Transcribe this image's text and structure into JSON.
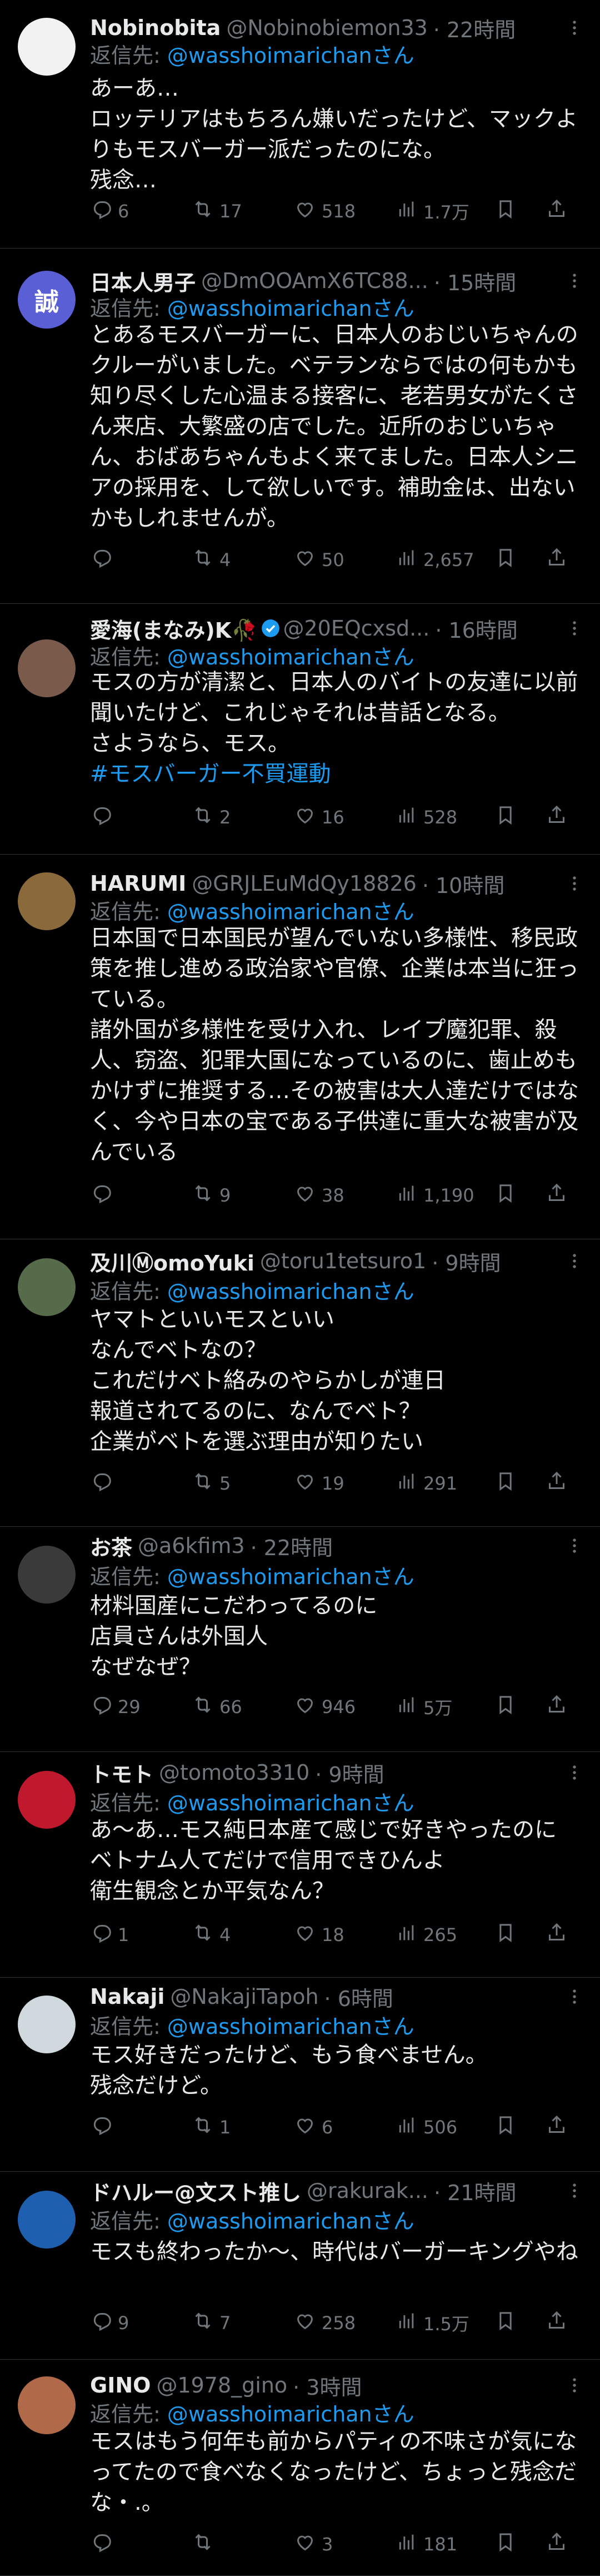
{
  "reply_prefix": "返信先: ",
  "colors": {
    "background": "#000000",
    "text": "#e7e9ea",
    "muted": "#71767b",
    "link": "#1d9bf0",
    "divider": "#2f3336"
  },
  "tweets": [
    {
      "name": "Nobinobita",
      "handle": "@Nobinobiemon33",
      "time": "· 22時間",
      "avatar": {
        "initial": "",
        "bg": "#f2f2f2"
      },
      "reply_to": "@wasshoimarichanさん",
      "text": "あーあ…\nロッテリアはもちろん嫌いだったけど、マックよりもモスバーガー派だったのにな。\n残念…",
      "replies": "6",
      "retweets": "17",
      "likes": "518",
      "views": "1.7万"
    },
    {
      "name": "日本人男子",
      "handle": "@DmOOAmX6TC88...",
      "time": "· 15時間",
      "avatar": {
        "initial": "誠",
        "bg": "#5a5fd6"
      },
      "reply_to": "@wasshoimarichanさん",
      "text": "とあるモスバーガーに、日本人のおじいちゃんのクルーがいました。ベテランならではの何もかも知り尽くした心温まる接客に、老若男女がたくさん来店、大繁盛の店でした。近所のおじいちゃん、おばあちゃんもよく来てました。日本人シニアの採用を、して欲しいです。補助金は、出ないかもしれませんが。",
      "replies": "",
      "retweets": "4",
      "likes": "50",
      "views": "2,657"
    },
    {
      "name": "愛海(まなみ)K🥀",
      "handle": "@20EQcxsd...",
      "time": "· 16時間",
      "avatar": {
        "initial": "",
        "bg": "#7a5a4a"
      },
      "reply_to": "@wasshoimarichanさん",
      "text": "モスの方が清潔と、日本人のバイトの友達に以前聞いたけど、これじゃそれは昔話となる。\nさようなら、モス。",
      "hashtag": "#モスバーガー不買運動",
      "replies": "",
      "retweets": "2",
      "likes": "16",
      "views": "528"
    },
    {
      "name": "HARUMI",
      "handle": "@GRJLEuMdQy18826",
      "time": "· 10時間",
      "avatar": {
        "initial": "",
        "bg": "#8a6a3a"
      },
      "reply_to": "@wasshoimarichanさん",
      "text": "日本国で日本国民が望んでいない多様性、移民政策を推し進める政治家や官僚、企業は本当に狂っている。\n諸外国が多様性を受け入れ、レイプ魔犯罪、殺人、窃盗、犯罪大国になっているのに、歯止めもかけずに推奨する…その被害は大人達だけではなく、今や日本の宝である子供達に重大な被害が及んでいる",
      "replies": "",
      "retweets": "9",
      "likes": "38",
      "views": "1,190"
    },
    {
      "name": "及川ⓂomoYuki",
      "handle": "@toru1tetsuro1",
      "time": "· 9時間",
      "avatar": {
        "initial": "",
        "bg": "#556b4a"
      },
      "reply_to": "@wasshoimarichanさん",
      "text": "ヤマトといいモスといい\nなんでベトなの？\nこれだけベト絡みのやらかしが連日\n報道されてるのに、なんでベト？\n企業がベトを選ぶ理由が知りたい",
      "replies": "",
      "retweets": "5",
      "likes": "19",
      "views": "291"
    },
    {
      "name": "お茶",
      "handle": "@a6kfim3",
      "time": "· 22時間",
      "avatar": {
        "initial": "",
        "bg": "#3a3a3a"
      },
      "reply_to": "@wasshoimarichanさん",
      "text": "材料国産にこだわってるのに\n店員さんは外国人\nなぜなぜ？",
      "replies": "29",
      "retweets": "66",
      "likes": "946",
      "views": "5万"
    },
    {
      "name": "トモト",
      "handle": "@tomoto3310",
      "time": "· 9時間",
      "avatar": {
        "initial": "",
        "bg": "#c0182c"
      },
      "reply_to": "@wasshoimarichanさん",
      "text": "あ〜あ…モス純日本産て感じで好きやったのに\nベトナム人てだけで信用できひんよ\n衛生観念とか平気なん？",
      "replies": "1",
      "retweets": "4",
      "likes": "18",
      "views": "265"
    },
    {
      "name": "Nakaji",
      "handle": "@NakajiTapoh",
      "time": "· 6時間",
      "avatar": {
        "initial": "",
        "bg": "#cfd9de"
      },
      "reply_to": "@wasshoimarichanさん",
      "text": "モス好きだったけど、もう食べません。\n残念だけど。",
      "replies": "",
      "retweets": "1",
      "likes": "6",
      "views": "506"
    },
    {
      "name": "ドハルー@文スト推し",
      "handle": "@rakurak...",
      "time": "· 21時間",
      "avatar": {
        "initial": "",
        "bg": "#1f5fb0"
      },
      "reply_to": "@wasshoimarichanさん",
      "text": "モスも終わったか〜、時代はバーガーキングやね",
      "replies": "9",
      "retweets": "7",
      "likes": "258",
      "views": "1.5万"
    },
    {
      "name": "GINO",
      "handle": "@1978_gino",
      "time": "· 3時間",
      "avatar": {
        "initial": "",
        "bg": "#b06a4a"
      },
      "reply_to": "@wasshoimarichanさん",
      "text": "モスはもう何年も前からパティの不味さが気になってたので食べなくなったけど、ちょっと残念だな・.。",
      "replies": "",
      "retweets": "",
      "likes": "3",
      "views": "181"
    }
  ]
}
